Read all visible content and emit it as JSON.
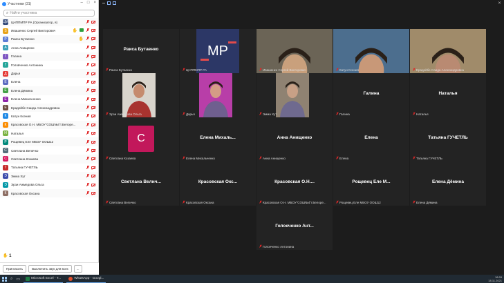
{
  "panel": {
    "title": "Участники (31)",
    "search_placeholder": "Найти участника",
    "participants": [
      {
        "initial": "ЦМ",
        "name": "ЦНППМПР РА (Организатор, я)",
        "color": "#334a7a"
      },
      {
        "initial": "S",
        "name": "Ивашенко Сергей Викторович",
        "color": "#e8a317"
      },
      {
        "initial": "Р",
        "name": "Раиса Бутаенко",
        "color": "#5b7bd5"
      },
      {
        "initial": "А",
        "name": "Анна Анищенко",
        "color": "#3aa0b8"
      },
      {
        "initial": "Г",
        "name": "Галина",
        "color": "#7e57c2"
      },
      {
        "initial": "Г",
        "name": "Головченко Антонина",
        "color": "#26a69a"
      },
      {
        "initial": "Д",
        "name": "Дарья",
        "color": "#e53935"
      },
      {
        "initial": "Е",
        "name": "Елена",
        "color": "#5c6bc0"
      },
      {
        "initial": "Е",
        "name": "Елена Дёмина",
        "color": "#43a047"
      },
      {
        "initial": "Е",
        "name": "Елена Михальченко",
        "color": "#8e24aa"
      },
      {
        "initial": "Е",
        "name": "Ерадейбе Саида Александровна",
        "color": "#6d4c41"
      },
      {
        "initial": "К",
        "name": "Катун Ксения",
        "color": "#1e88e5"
      },
      {
        "initial": "К",
        "name": "Красовская О.Н. МБОУ\"СОШ№4\"г.Белоре...",
        "color": "#fb8c00"
      },
      {
        "initial": "Н",
        "name": "Наталья",
        "color": "#7cb342"
      },
      {
        "initial": "Р",
        "name": "Рощевец Еле МБОУ ООШ12",
        "color": "#00897b"
      },
      {
        "initial": "С",
        "name": "Светлана Величко",
        "color": "#546e7a"
      },
      {
        "initial": "С",
        "name": "Светлана Козаева",
        "color": "#d81b60"
      },
      {
        "initial": "Т",
        "name": "Татьяна ГУЧЕТЛЬ",
        "color": "#c62828"
      },
      {
        "initial": "Э",
        "name": "Эмма Хут",
        "color": "#3949ab"
      },
      {
        "initial": "Э",
        "name": "Эрзи Ажмедова Ольга",
        "color": "#0097a7"
      },
      {
        "initial": "К",
        "name": "Красовская Оксана",
        "color": "#8d6e63"
      }
    ],
    "raised_count": "1",
    "invite_label": "Пригласить",
    "mute_all_label": "Выключить звук для всех",
    "more_label": "..."
  },
  "tiles": [
    {
      "display": "Раиса Бутаенко",
      "label": "Раиса Бутаенко",
      "kind": "name"
    },
    {
      "display": "MP",
      "label": "ЦНППМПР РА",
      "kind": "mp"
    },
    {
      "display": "",
      "label": "Ивашенко Сергей Викторович",
      "kind": "video",
      "bg": "#6b6456",
      "skin": "#c9a07c",
      "shirt": "#2b2e3a",
      "speaking": true
    },
    {
      "display": "",
      "label": "Катун Ксения",
      "kind": "video",
      "bg": "#4c6e8e",
      "skin": "#c89878",
      "shirt": "#556b86"
    },
    {
      "display": "",
      "label": "Ерадейбе Саида Александровна",
      "kind": "video",
      "bg": "#a08b6a",
      "skin": "#b98a72",
      "shirt": "#b03aa0"
    },
    {
      "display": "",
      "label": "Эрзи Ажмедова Ольга",
      "kind": "video",
      "bg": "#d8d4cc",
      "skin": "#c58b6e",
      "shirt": "#a8332f"
    },
    {
      "display": "",
      "label": "Дарья",
      "kind": "video",
      "bg": "#b83ea8",
      "skin": "#d49c86",
      "shirt": "#6f5f8f"
    },
    {
      "display": "",
      "label": "Эмма Хут",
      "kind": "video",
      "bg": "#8f8272",
      "skin": "#c8a086",
      "shirt": "#6f6a8f"
    },
    {
      "display": "Галина",
      "label": "Галина",
      "kind": "name"
    },
    {
      "display": "Наталья",
      "label": "Наталья",
      "kind": "name"
    },
    {
      "display": "C",
      "label": "Светлана Козаева",
      "kind": "c"
    },
    {
      "display": "Елена Михаль...",
      "label": "Елена Михальченко",
      "kind": "name"
    },
    {
      "display": "Анна Анищенко",
      "label": "Анна Анищенко",
      "kind": "name"
    },
    {
      "display": "Елена",
      "label": "Елена",
      "kind": "name"
    },
    {
      "display": "Татьяна ГУЧЕТЛЬ",
      "label": "Татьяна ГУЧЕТЛЬ",
      "kind": "name"
    },
    {
      "display": "Светлана Велич...",
      "label": "Светлана Величко",
      "kind": "name"
    },
    {
      "display": "Красовская Окс...",
      "label": "Красовская Оксана",
      "kind": "name"
    },
    {
      "display": "Красовская О.Н....",
      "label": "Красовская О.Н. МБОУ\"СОШ№4\"г.Белоре...",
      "kind": "name"
    },
    {
      "display": "Рощевец Еле М...",
      "label": "Рощевец Еле МБОУ ООШ12",
      "kind": "name"
    },
    {
      "display": "Елена Дёмина",
      "label": "Елена Дёмина",
      "kind": "name"
    },
    {
      "display": "Голоеченко Ант...",
      "label": "Голоеченко Антонина",
      "kind": "name"
    }
  ],
  "taskbar": {
    "app1": "Microsoft Excel - Т...",
    "app2": "WhatsApp - Googl...",
    "time": "18:28",
    "date": "18.11.2021"
  }
}
